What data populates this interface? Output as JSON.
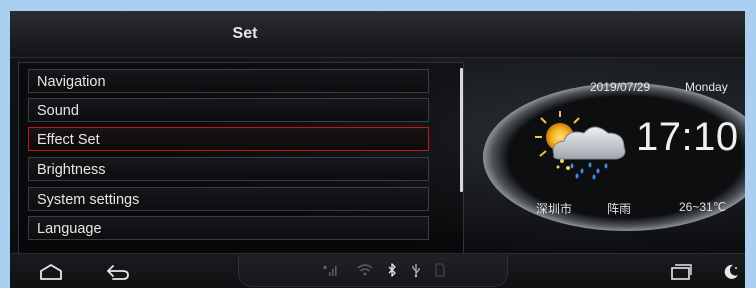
{
  "header": {
    "title": "Set"
  },
  "menu": {
    "items": [
      {
        "label": "Navigation"
      },
      {
        "label": "Sound"
      },
      {
        "label": "Effect Set",
        "selected": true
      },
      {
        "label": "Brightness"
      },
      {
        "label": "System settings"
      },
      {
        "label": "Language"
      }
    ]
  },
  "clock": {
    "date": "2019/07/29",
    "day": "Monday",
    "time": "17:10",
    "city": "深圳市",
    "weather": "阵雨",
    "temperature": "26~31℃",
    "weather_icon": "sun-cloud-rain-icon"
  },
  "bottombar": {
    "left_icons": [
      "home-icon",
      "back-icon"
    ],
    "status_icons": [
      "signal-icon",
      "wifi-icon",
      "bluetooth-icon",
      "usb-icon",
      "sdcard-icon"
    ],
    "right_icons": [
      "recent-apps-icon",
      "night-mode-icon"
    ]
  },
  "colors": {
    "selected_border": "#c01818",
    "background": "#0c0d0f",
    "outer_background": "#a9d0f0"
  }
}
